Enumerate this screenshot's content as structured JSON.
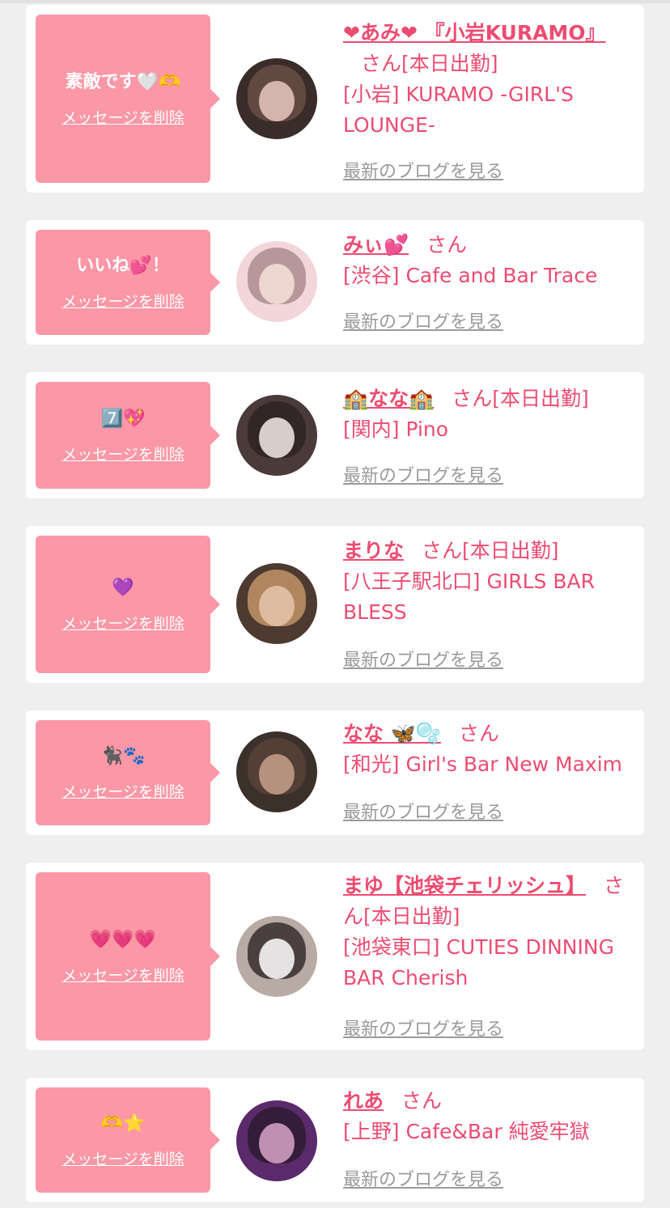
{
  "delete_label": "メッセージを削除",
  "blog_label": "最新のブログを見る",
  "accent_color": "#ed4c71",
  "bubble_color": "#fb97a6",
  "cards": [
    {
      "message": "素敵です🤍🫶",
      "name": "❤あみ❤ 『小岩KURAMO』",
      "suffix": "さん[本日出勤]",
      "shop": "[小岩] KURAMO -GIRL'S LOUNGE-"
    },
    {
      "message": "いいね💕！",
      "name": "みぃ💕",
      "suffix": "さん",
      "shop": "[渋谷] Cafe and Bar Trace"
    },
    {
      "message": "7️⃣💖",
      "name": "🏫なな🏫",
      "suffix": "さん[本日出勤]",
      "shop": "[関内] Pino"
    },
    {
      "message": "💜",
      "name": "まりな",
      "suffix": "さん[本日出勤]",
      "shop": "[八王子駅北口] GIRLS BAR BLESS"
    },
    {
      "message": "🐈‍⬛🐾",
      "name": "なな 🦋🫧",
      "suffix": "さん",
      "shop": "[和光] Girl's Bar New Maxim"
    },
    {
      "message": "💗💗💗",
      "name": "まゆ【池袋チェリッシュ】",
      "suffix": "さん[本日出勤]",
      "shop": "[池袋東口] CUTIES DINNING BAR Cherish"
    },
    {
      "message": "🫶⭐",
      "name": "れあ",
      "suffix": "さん",
      "shop": "[上野] Cafe&Bar 純愛牢獄"
    }
  ]
}
